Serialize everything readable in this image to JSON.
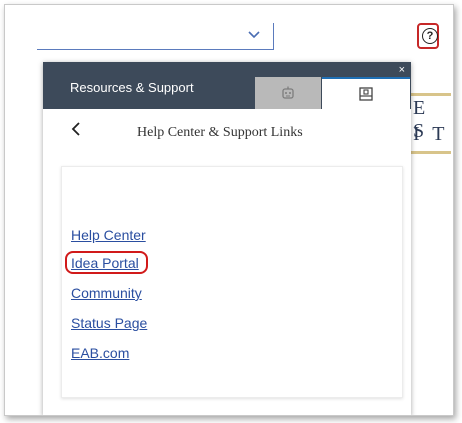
{
  "background": {
    "title_fragment_line1": "E S",
    "title_fragment_line2": "I T"
  },
  "panel": {
    "title": "Resources & Support",
    "close_glyph": "×",
    "tabs": [
      {
        "name": "tab-chat",
        "icon": "robot-icon"
      },
      {
        "name": "tab-support-links",
        "icon": "links-panel-icon",
        "active": true
      }
    ],
    "nav": {
      "back_glyph": "<",
      "title": "Help Center & Support Links"
    },
    "links": [
      {
        "label": "Help Center"
      },
      {
        "label": "Idea Portal",
        "highlighted": true
      },
      {
        "label": "Community"
      },
      {
        "label": "Status Page"
      },
      {
        "label": "EAB.com"
      }
    ]
  },
  "colors": {
    "header": "#3d4a5a",
    "active_tab_accent": "#1f6fb5",
    "link": "#2a4ea0",
    "highlight": "#d11a1a"
  }
}
